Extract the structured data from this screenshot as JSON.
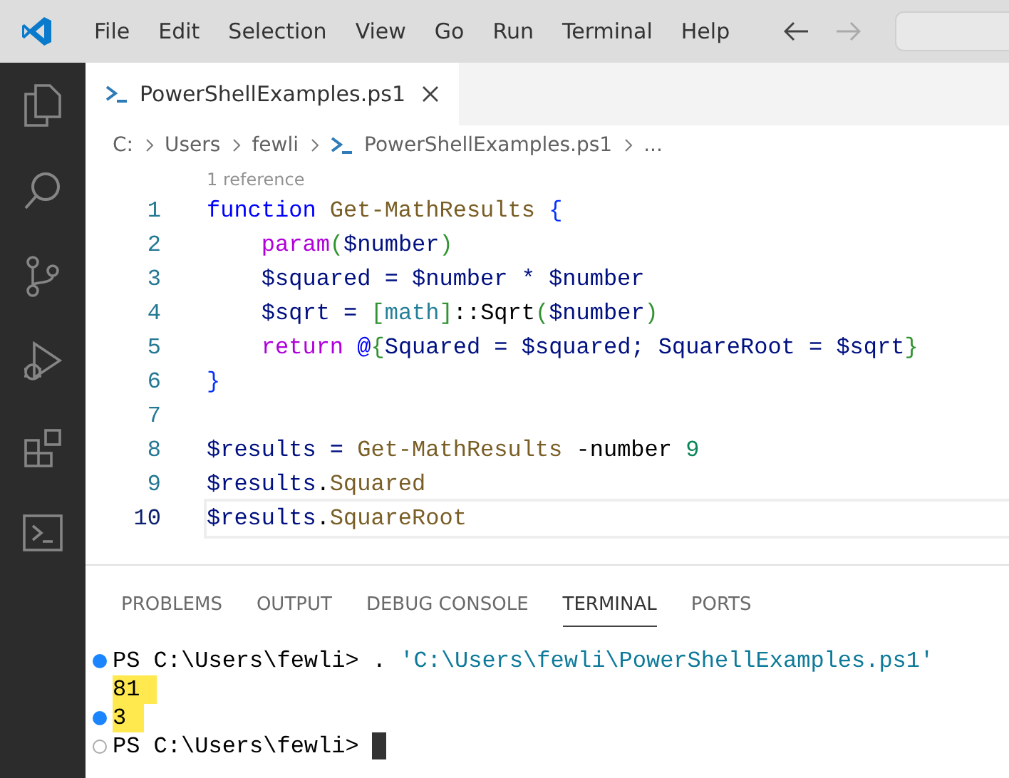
{
  "menu": [
    "File",
    "Edit",
    "Selection",
    "View",
    "Go",
    "Run",
    "Terminal",
    "Help"
  ],
  "activity_bar": [
    {
      "kind": "explorer",
      "selected": false
    },
    {
      "kind": "search",
      "selected": false
    },
    {
      "kind": "source-control",
      "selected": false
    },
    {
      "kind": "run-debug",
      "selected": false
    },
    {
      "kind": "extensions",
      "selected": false
    },
    {
      "kind": "terminal",
      "selected": false
    }
  ],
  "editor_tabs": [
    {
      "label": "PowerShellExamples.ps1",
      "selected": true
    }
  ],
  "breadcrumb": [
    "C:",
    "Users",
    "fewli",
    "PowerShellExamples.ps1",
    "..."
  ],
  "codelens": "1 reference",
  "code": [
    {
      "number": "1",
      "current": false,
      "indented": false,
      "tokens": [
        {
          "text": "function",
          "kind": "keyword"
        },
        {
          "text": "Get-MathResults",
          "kind": "func"
        },
        {
          "text": "{",
          "kind": "brace1"
        }
      ]
    },
    {
      "number": "2",
      "current": false,
      "indented": true,
      "tokens": [
        {
          "text": "param",
          "kind": "control"
        },
        {
          "text": "(",
          "kind": "brace2"
        },
        {
          "text": "$number",
          "kind": "var"
        },
        {
          "text": ")",
          "kind": "brace2"
        }
      ]
    },
    {
      "number": "3",
      "current": false,
      "indented": true,
      "tokens": [
        {
          "text": "$squared = $number * $number",
          "kind": "var"
        }
      ]
    },
    {
      "number": "4",
      "current": false,
      "indented": true,
      "tokens": [
        {
          "text": "$sqrt =",
          "kind": "var"
        },
        {
          "text": "[",
          "kind": "brace2"
        },
        {
          "text": "math",
          "kind": "type"
        },
        {
          "text": "]",
          "kind": "brace2"
        },
        {
          "text": "::Sqrt",
          "kind": "plain"
        },
        {
          "text": "(",
          "kind": "brace2"
        },
        {
          "text": "$number",
          "kind": "var"
        },
        {
          "text": ")",
          "kind": "brace2"
        }
      ]
    },
    {
      "number": "5",
      "current": false,
      "indented": true,
      "tokens": [
        {
          "text": "return",
          "kind": "control"
        },
        {
          "text": "@",
          "kind": "keyword"
        },
        {
          "text": "{",
          "kind": "brace2"
        },
        {
          "text": "Squared = $squared; SquareRoot = $sqrt",
          "kind": "var"
        },
        {
          "text": "}",
          "kind": "brace2"
        }
      ]
    },
    {
      "number": "6",
      "current": false,
      "indented": false,
      "tokens": [
        {
          "text": "}",
          "kind": "brace1"
        }
      ]
    },
    {
      "number": "7",
      "current": false
    },
    {
      "number": "8",
      "current": false,
      "indented": false,
      "tokens": [
        {
          "text": "$results =",
          "kind": "var"
        },
        {
          "text": "Get-MathResults",
          "kind": "func"
        },
        {
          "text": "-number",
          "kind": "plain"
        },
        {
          "text": "9",
          "kind": "number"
        }
      ]
    },
    {
      "number": "9",
      "current": false,
      "indented": false,
      "tokens": [
        {
          "text": "$results",
          "kind": "var"
        },
        {
          "text": ".",
          "kind": "plain"
        },
        {
          "text": "Squared",
          "kind": "func"
        }
      ]
    },
    {
      "number": "10",
      "current": true,
      "indented": false,
      "tokens": [
        {
          "text": "$results",
          "kind": "var"
        },
        {
          "text": ".",
          "kind": "plain"
        },
        {
          "text": "SquareRoot",
          "kind": "func"
        }
      ]
    }
  ],
  "panel_tabs": [
    {
      "label": "PROBLEMS",
      "selected": false
    },
    {
      "label": "OUTPUT",
      "selected": false
    },
    {
      "label": "DEBUG CONSOLE",
      "selected": false
    },
    {
      "label": "TERMINAL",
      "selected": true
    },
    {
      "label": "PORTS",
      "selected": false
    }
  ],
  "terminal": [
    {
      "kind": "success",
      "highlighted": false,
      "cursor": false,
      "segments": [
        {
          "text": "PS C:\\Users\\fewli> .",
          "kind": "plain"
        },
        {
          "text": "'C:\\Users\\fewli\\PowerShellExamples.ps1'",
          "kind": "string"
        }
      ]
    },
    {
      "kind": "none",
      "highlighted": true,
      "cursor": false,
      "segments": [
        {
          "text": "81",
          "kind": "plain"
        }
      ]
    },
    {
      "kind": "success",
      "highlighted": true,
      "cursor": false,
      "segments": [
        {
          "text": "3",
          "kind": "plain"
        }
      ]
    },
    {
      "kind": "empty",
      "highlighted": false,
      "cursor": true,
      "segments": [
        {
          "text": "PS C:\\Users\\fewli>",
          "kind": "plain"
        }
      ]
    }
  ]
}
